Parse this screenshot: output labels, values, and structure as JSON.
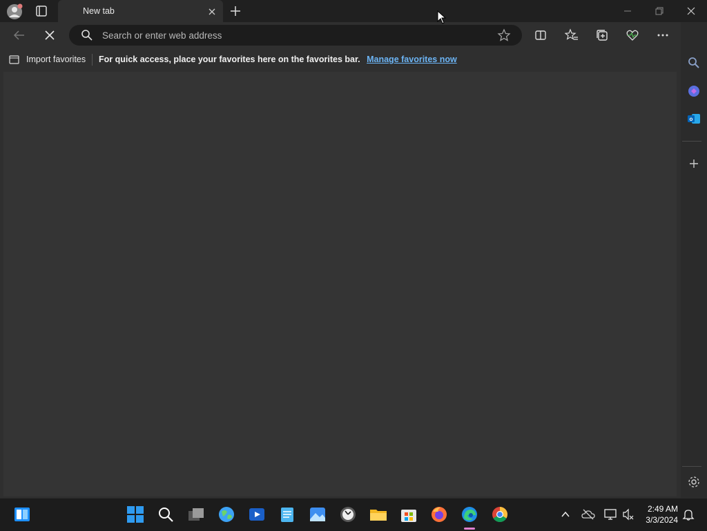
{
  "tab": {
    "title": "New tab"
  },
  "address": {
    "placeholder": "Search or enter web address"
  },
  "favorites": {
    "import_label": "Import favorites",
    "message": "For quick access, place your favorites here on the favorites bar.",
    "link": "Manage favorites now"
  },
  "clock": {
    "time": "2:49 AM",
    "date": "3/3/2024"
  },
  "colors": {
    "accent": "#6cb4f4",
    "frame": "#202020",
    "toolbar": "#2f2f2f",
    "content": "#343434"
  },
  "icons": {
    "toolbar": [
      "back-icon",
      "stop-icon",
      "search-icon",
      "favorite-star-icon",
      "split-screen-icon",
      "favorites-icon",
      "collections-icon",
      "browser-essentials-icon",
      "more-icon",
      "copilot-icon"
    ],
    "sidebar": [
      "search-icon",
      "copilot-icon",
      "outlook-icon",
      "add-icon",
      "settings-icon"
    ],
    "taskbar": [
      "widgets-icon",
      "start-icon",
      "search-icon",
      "task-view-icon",
      "maps-icon",
      "media-player-icon",
      "notepad-icon",
      "photos-icon",
      "clock-icon",
      "file-explorer-icon",
      "store-icon",
      "firefox-icon",
      "edge-icon",
      "chrome-icon"
    ]
  }
}
